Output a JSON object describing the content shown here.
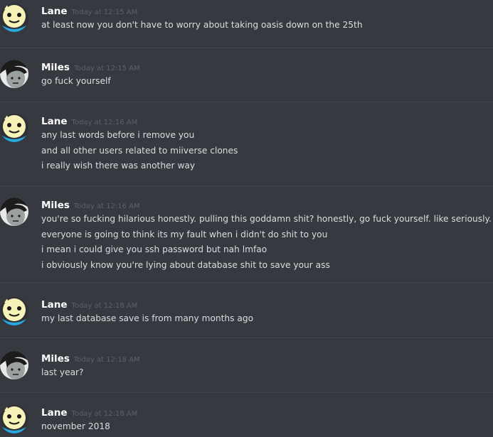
{
  "messages": [
    {
      "author": "Lane",
      "timestamp": "Today at 12:15 AM",
      "avatar_icon": "lane-avatar-icon",
      "lines": [
        "at least now you don't have to worry about taking oasis down on the 25th"
      ]
    },
    {
      "author": "Miles",
      "timestamp": "Today at 12:15 AM",
      "avatar_icon": "miles-avatar-icon",
      "lines": [
        "go fuck yourself"
      ]
    },
    {
      "author": "Lane",
      "timestamp": "Today at 12:16 AM",
      "avatar_icon": "lane-avatar-icon",
      "lines": [
        "any last words before i remove you",
        "and all other users related to miiverse clones",
        "i really wish there was another way"
      ]
    },
    {
      "author": "Miles",
      "timestamp": "Today at 12:16 AM",
      "avatar_icon": "miles-avatar-icon",
      "lines": [
        "you're so fucking hilarious honestly. pulling this goddamn shit? honestly, go fuck yourself. like seriously.",
        "everyone is going to think its my fault when i didn't do shit to you",
        "i mean i could give you ssh password but nah lmfao",
        "i obviously know you're lying about database shit to save your ass"
      ]
    },
    {
      "author": "Lane",
      "timestamp": "Today at 12:18 AM",
      "avatar_icon": "lane-avatar-icon",
      "lines": [
        "my last database save is from many months ago"
      ]
    },
    {
      "author": "Miles",
      "timestamp": "Today at 12:18 AM",
      "avatar_icon": "miles-avatar-icon",
      "lines": [
        "last year?"
      ]
    },
    {
      "author": "Lane",
      "timestamp": "Today at 12:18 AM",
      "avatar_icon": "lane-avatar-icon",
      "lines": [
        "november 2018"
      ]
    }
  ],
  "colors": {
    "background": "#36393f",
    "divider": "#42454a",
    "username": "#ffffff",
    "timestamp": "#5d6066",
    "message_text": "#dcddde"
  }
}
